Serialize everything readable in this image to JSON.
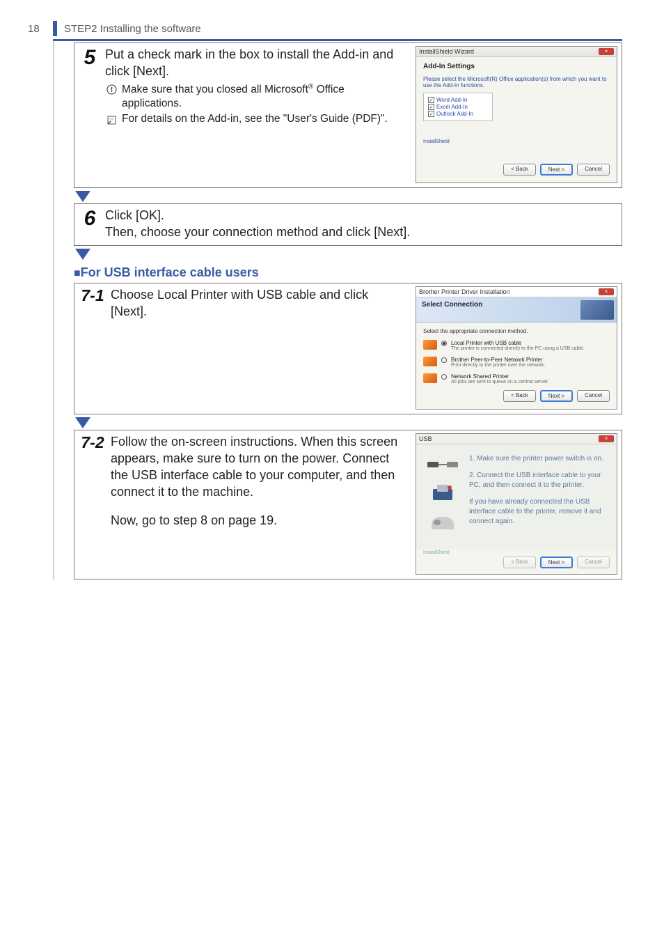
{
  "header": {
    "page_number": "18",
    "title": "STEP2 Installing the software"
  },
  "step5": {
    "number": "5",
    "main": "Put a check mark in the box to install the Add-in and click [Next].",
    "bullet1": "Make sure that you closed all Microsoft",
    "bullet1_sup": "®",
    "bullet1_cont": " Office applications.",
    "bullet2": "For details on the Add-in, see the \"User's Guide (PDF)\".",
    "dialog": {
      "title": "InstallShield Wizard",
      "heading": "Add-In Settings",
      "msg": "Please select the Microsoft(R) Office application(s) from which you want to use the Add-In functions.",
      "check1": "Word Add-In",
      "check2": "Excel Add-In",
      "check3": "Outlook Add-In",
      "install_shield": "InstallShield",
      "btn_back": "< Back",
      "btn_next": "Next >",
      "btn_cancel": "Cancel"
    }
  },
  "step6": {
    "number": "6",
    "line1": "Click [OK].",
    "line2": "Then, choose your connection method and click [Next]."
  },
  "section_usb": {
    "heading": "For USB interface cable users"
  },
  "step7_1": {
    "number": "7-1",
    "main": "Choose Local Printer with USB cable and click [Next].",
    "dialog": {
      "title": "Brother Printer Driver Installation",
      "heading": "Select Connection",
      "select_line": "Select the appropriate connection method.",
      "opt1_title": "Local Printer with USB cable",
      "opt1_sub": "The printer is connected directly to the PC using a USB cable.",
      "opt2_title": "Brother Peer-to-Peer Network Printer",
      "opt2_sub": "Print directly to the printer over the network.",
      "opt3_title": "Network Shared Printer",
      "opt3_sub": "All jobs are sent to queue on a central server.",
      "btn_back": "< Back",
      "btn_next": "Next >",
      "btn_cancel": "Cancel"
    }
  },
  "step7_2": {
    "number": "7-2",
    "main": "Follow the on-screen instructions. When this screen appears, make sure to turn on the power. Connect the USB interface cable to your computer, and then connect it to the machine.",
    "sub": "Now, go to step 8 on page 19.",
    "dialog": {
      "title": "USB",
      "line1": "1. Make sure the printer power switch is on.",
      "line2": "2. Connect the USB interface cable to your PC, and then connect it to the printer.",
      "line3": "If you have already connected the USB interface cable to the printer, remove it and connect again.",
      "install_shield": "InstallShield",
      "btn_back": "< Back",
      "btn_next": "Next >",
      "btn_cancel": "Cancel"
    }
  }
}
